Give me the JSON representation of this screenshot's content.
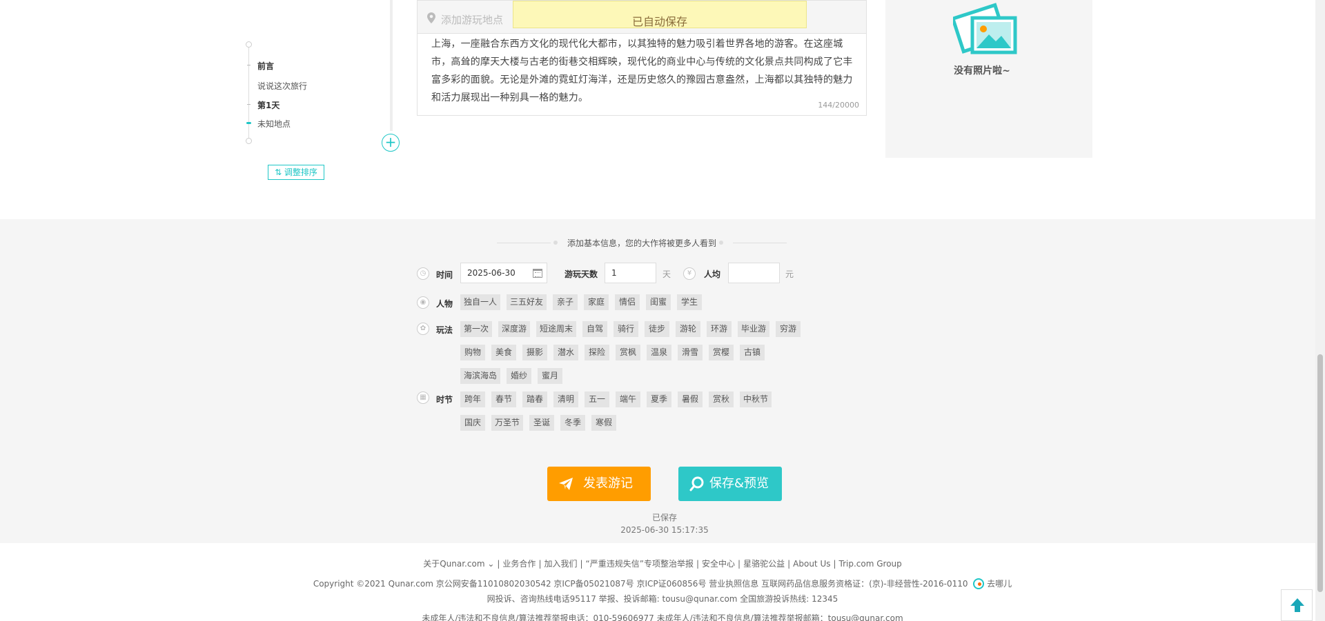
{
  "outline": {
    "items": [
      {
        "label": "前言",
        "bold": true
      },
      {
        "label": "说说这次旅行",
        "bold": false
      },
      {
        "label": "第1天",
        "bold": true
      },
      {
        "label": "未知地点",
        "bold": false
      }
    ],
    "sort_button": "⇅ 调整排序",
    "add_button": "+"
  },
  "editor": {
    "place_placeholder": "添加游玩地点",
    "autosave_text": "已自动保存",
    "body": "上海，一座融合东西方文化的现代化大都市，以其独特的魅力吸引着世界各地的游客。在这座城市，高耸的摩天大楼与古老的街巷交相辉映，现代化的商业中心与传统的文化景点共同构成了它丰富多彩的面貌。无论是外滩的霓虹灯海洋，还是历史悠久的豫园古意盎然，上海都以其独特的魅力和活力展现出一种别具一格的魅力。",
    "counter": "144/20000"
  },
  "photos": {
    "empty_text": "没有照片啦~"
  },
  "basic_info": {
    "hint": "添加基本信息，您的大作将被更多人看到",
    "time_label": "时间",
    "date_value": "2025-06-30",
    "days_label": "游玩天数",
    "days_value": "1",
    "days_unit": "天",
    "avg_label": "人均",
    "avg_value": "",
    "avg_unit": "元",
    "people_label": "人物",
    "people_tags": [
      "独自一人",
      "三五好友",
      "亲子",
      "家庭",
      "情侣",
      "闺蜜",
      "学生"
    ],
    "play_label": "玩法",
    "play_tags_row1": [
      "第一次",
      "深度游",
      "短途周末",
      "自驾",
      "骑行",
      "徒步",
      "游轮",
      "环游",
      "毕业游",
      "穷游"
    ],
    "play_tags_row2": [
      "购物",
      "美食",
      "摄影",
      "潜水",
      "探险",
      "赏枫",
      "温泉",
      "滑雪",
      "赏樱",
      "古镇"
    ],
    "play_tags_row3": [
      "海滨海岛",
      "婚纱",
      "蜜月"
    ],
    "season_label": "时节",
    "season_tags_row1": [
      "跨年",
      "春节",
      "踏春",
      "清明",
      "五一",
      "端午",
      "夏季",
      "暑假",
      "赏秋",
      "中秋节"
    ],
    "season_tags_row2": [
      "国庆",
      "万圣节",
      "圣诞",
      "冬季",
      "寒假"
    ]
  },
  "actions": {
    "publish": "发表游记",
    "save_preview": "保存&预览",
    "saved_label": "已保存",
    "saved_time": "2025-06-30 15:17:35"
  },
  "footer": {
    "links": [
      "关于Qunar.com ⌄",
      "业务合作",
      "加入我们",
      "“严重违规失信”专项整治举报",
      "安全中心",
      "星骆驼公益",
      "About Us",
      "Trip.com Group"
    ],
    "copyright": "Copyright ©2021 Qunar.com   京公网安备11010802030542   京ICP备05021087号   京ICP证060856号   营业执照信息   互联网药品信息服务资格证：(京)-非经营性-2016-0110",
    "qunar_text": "去哪儿",
    "hotline": "网投诉、咨询热线电话95117  举报、投诉邮箱: tousu@qunar.com  全国旅游投诉热线: 12345",
    "minor": "未成年人/违法和不良信息/算法推荐举报电话：010-59606977  未成年人/违法和不良信息/算法推荐举报邮箱：tousu@qunar.com"
  },
  "colors": {
    "accent": "#2ec8c8",
    "publish": "#ff9d00"
  }
}
